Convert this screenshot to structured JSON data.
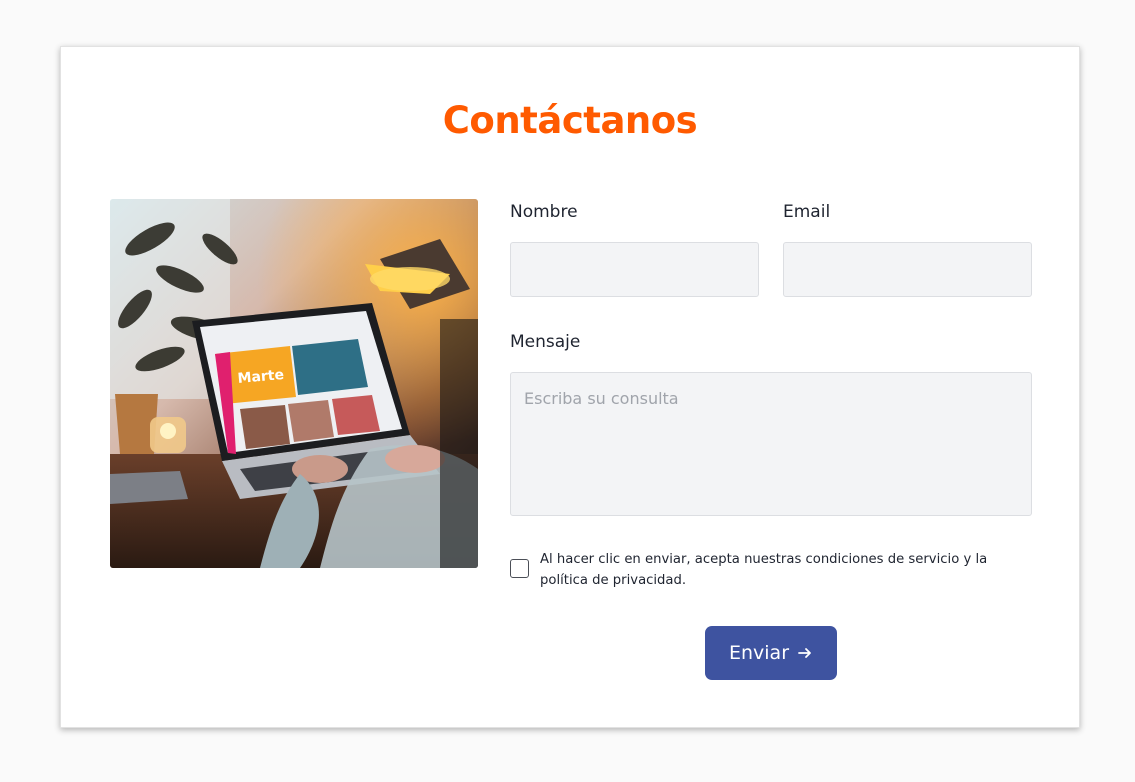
{
  "form": {
    "title": "Contáctanos",
    "name_label": "Nombre",
    "email_label": "Email",
    "message_label": "Mensaje",
    "message_placeholder": "Escriba su consulta",
    "consent_text": "Al hacer clic en enviar, acepta nuestras condiciones de servicio y la política de privacidad.",
    "submit_label": "Enviar",
    "submit_icon": "arrow-right-icon"
  },
  "image": {
    "screen_brand_text": "Marte"
  },
  "colors": {
    "title": "#ff5a00",
    "button": "#3e53a0",
    "field_bg": "#f3f4f6"
  }
}
